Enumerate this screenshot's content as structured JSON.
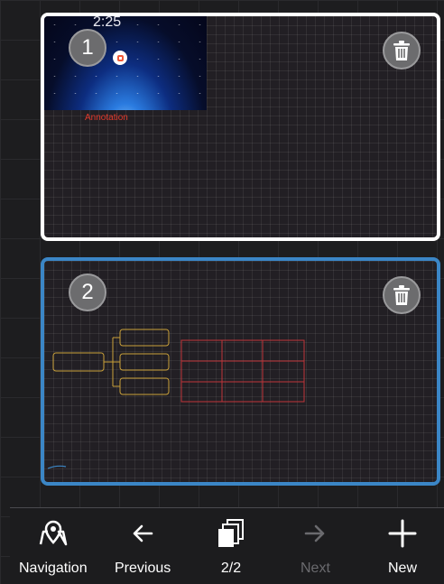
{
  "pages": [
    {
      "number": "1",
      "thumbnail": {
        "clock": "2:25",
        "annotation_label": "Annotation"
      }
    },
    {
      "number": "2"
    }
  ],
  "toolbar": {
    "navigation_label": "Navigation",
    "previous_label": "Previous",
    "page_counter": "2/2",
    "next_label": "Next",
    "new_label": "New"
  },
  "colors": {
    "selected_page_border": "#3b86c6",
    "page_border": "#ffffff",
    "annotation_text": "#e53a2c",
    "mindmap_stroke": "#c9a03a",
    "table_stroke": "#c0343a",
    "disabled_text": "#6a6a6e"
  },
  "icons": {
    "delete": "trash-icon",
    "navigation": "map-pin-icon",
    "previous": "arrow-left-icon",
    "pages": "stacked-pages-icon",
    "next": "arrow-right-icon",
    "new": "plus-icon"
  }
}
